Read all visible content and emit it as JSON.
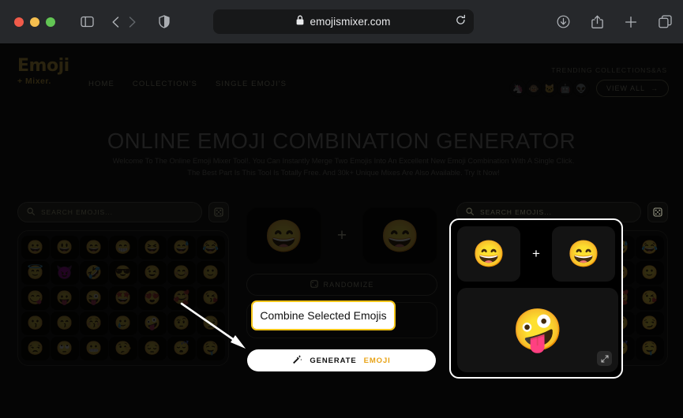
{
  "browser": {
    "url": "emojismixer.com",
    "lock_icon": "lock-icon",
    "reload_icon": "reload-icon",
    "sidebar_icon": "sidebar-toggle-icon",
    "back_icon": "back-chevron-icon",
    "forward_icon": "forward-chevron-icon",
    "shield_icon": "privacy-shield-icon",
    "download_icon": "download-icon",
    "share_icon": "share-icon",
    "newtab_icon": "plus-icon",
    "tabs_icon": "tab-overview-icon",
    "traffic": {
      "close": "close-button",
      "minimize": "minimize-button",
      "zoom": "zoom-button"
    }
  },
  "site": {
    "logo_main": "Emoji",
    "logo_sub": "+ Mixer.",
    "nav": [
      {
        "label": "HOME"
      },
      {
        "label": "COLLECTION'S"
      },
      {
        "label": "SINGLE EMOJI'S"
      }
    ],
    "trending_label": "TRENDING COLLECTIONS&AS",
    "trending_chips": [
      "🦄",
      "🐵",
      "🐱",
      "🤖",
      "👽"
    ],
    "view_all": "VIEW ALL",
    "view_all_arrow": "→"
  },
  "hero": {
    "title": "ONLINE EMOJI COMBINATION GENERATOR",
    "subtitle": "Welcome To The Online Emoji Mixer Tool!. You Can Instantly Merge Two Emojis Into An Excellent New Emoji Combination With A Single Click. The Best Part Is This Tool Is Totally Free. And 30k+ Unique Mixes Are Also Available. Try It Now!"
  },
  "picker": {
    "search_placeholder": "SEARCH EMOJIS...",
    "search_value": "",
    "search_icon": "search-icon",
    "shuffle_icon": "shuffle-icon",
    "grid_emojis": [
      "😀",
      "😃",
      "😄",
      "😁",
      "😆",
      "😅",
      "😂",
      "😇",
      "😈",
      "🤣",
      "😎",
      "😉",
      "😊",
      "🙂",
      "😋",
      "😛",
      "😜",
      "🤩",
      "😍",
      "🥰",
      "😘",
      "😗",
      "😙",
      "😚",
      "🥲",
      "🤪",
      "🤨",
      "😏",
      "😒",
      "🙄",
      "😬",
      "🤥",
      "😔",
      "😴",
      "🤤"
    ]
  },
  "combiner": {
    "slot_a": "😄",
    "slot_b": "😄",
    "plus": "+",
    "randomize_label": "RANDOMIZE",
    "randomize_icon": "dice-icon",
    "generate_label_main": "GENERATE",
    "generate_label_accent": "EMOJI",
    "generate_icon": "magic-wand-icon"
  },
  "highlight": {
    "slot_a": "😄",
    "slot_b": "😄",
    "plus": "+",
    "result_emoji": "🤪",
    "expand_icon": "expand-icon"
  },
  "annotation": {
    "tooltip_text": "Combine Selected Emojis",
    "arrow": "pointer-arrow"
  },
  "colors": {
    "accent_yellow": "#f5c518",
    "generate_accent": "#e8a317",
    "highlight_border": "#ffffff",
    "page_bg": "#050505",
    "chrome_bg": "#26282b"
  }
}
